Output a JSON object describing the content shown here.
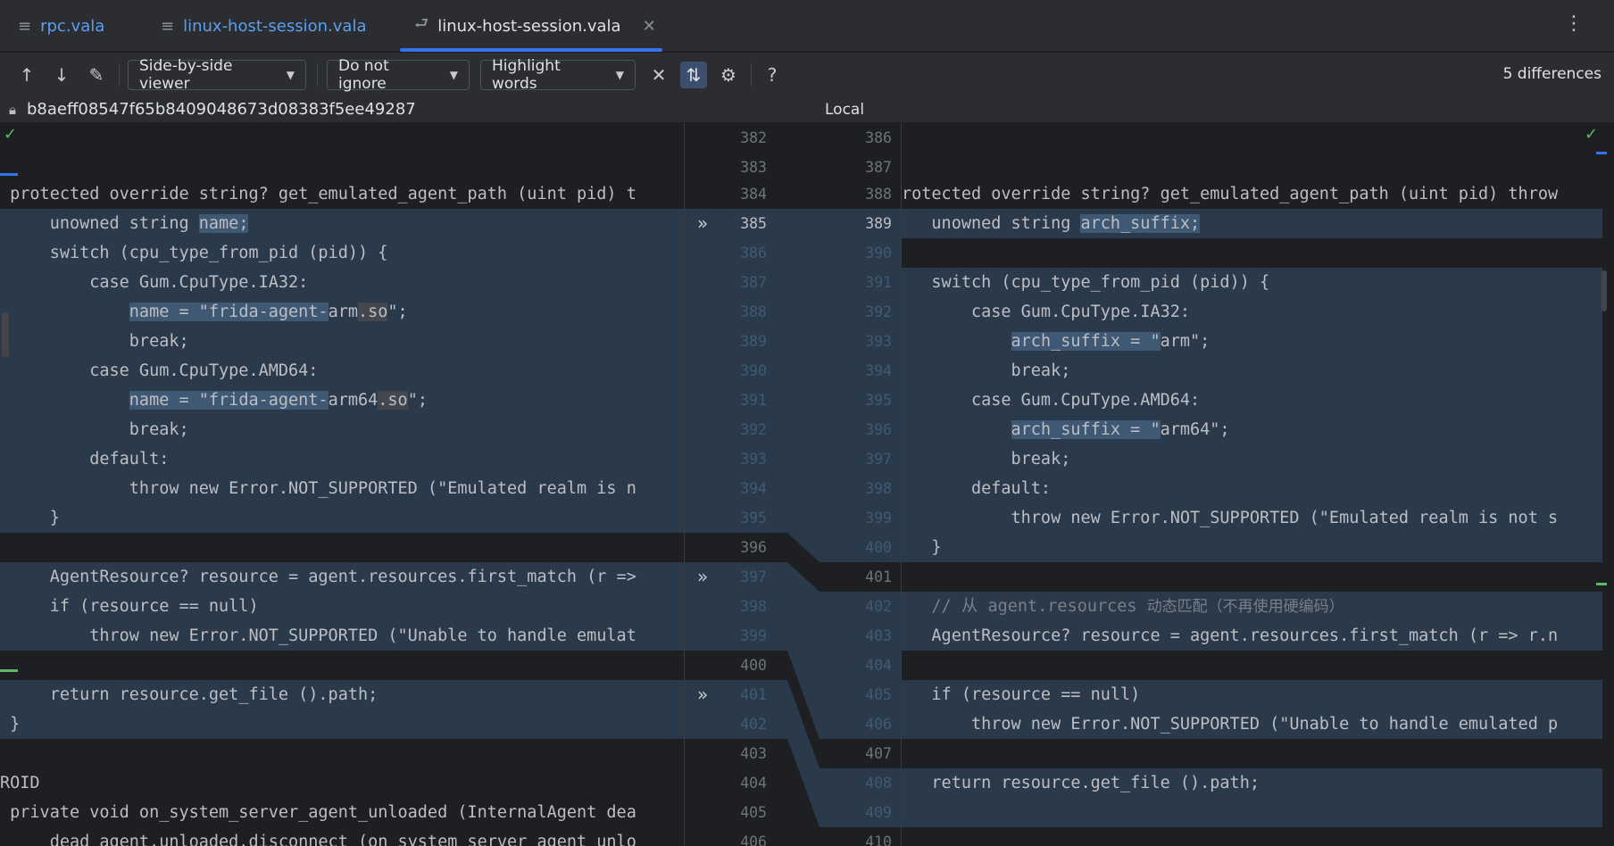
{
  "tabs": [
    {
      "label": "rpc.vala",
      "icon": "text-file-icon"
    },
    {
      "label": "linux-host-session.vala",
      "icon": "text-file-icon"
    },
    {
      "label": "linux-host-session.vala",
      "icon": "diff-icon"
    }
  ],
  "toolbar": {
    "viewer": "Side-by-side viewer",
    "ignore": "Do not ignore",
    "highlight": "Highlight words",
    "differences": "5 differences"
  },
  "title": {
    "left_revision": "b8aeff08547f65b8409048673d08383f5ee49287",
    "right": "Local"
  },
  "left_lines": [
    {
      "n": "382",
      "text": ""
    },
    {
      "n": "383",
      "text": ""
    },
    {
      "n": "384",
      "text": " protected override string? get_emulated_agent_path (uint pid) t"
    },
    {
      "n": "385",
      "text": "     unowned string name;"
    },
    {
      "n": "386",
      "text": "     switch (cpu_type_from_pid (pid)) {"
    },
    {
      "n": "387",
      "text": "         case Gum.CpuType.IA32:"
    },
    {
      "n": "388",
      "text": "             name = \"frida-agent-arm.so\";"
    },
    {
      "n": "389",
      "text": "             break;"
    },
    {
      "n": "390",
      "text": "         case Gum.CpuType.AMD64:"
    },
    {
      "n": "391",
      "text": "             name = \"frida-agent-arm64.so\";"
    },
    {
      "n": "392",
      "text": "             break;"
    },
    {
      "n": "393",
      "text": "         default:"
    },
    {
      "n": "394",
      "text": "             throw new Error.NOT_SUPPORTED (\"Emulated realm is n"
    },
    {
      "n": "395",
      "text": "     }"
    },
    {
      "n": "396",
      "text": ""
    },
    {
      "n": "397",
      "text": "     AgentResource? resource = agent.resources.first_match (r =>"
    },
    {
      "n": "398",
      "text": "     if (resource == null)"
    },
    {
      "n": "399",
      "text": "         throw new Error.NOT_SUPPORTED (\"Unable to handle emulat"
    },
    {
      "n": "400",
      "text": ""
    },
    {
      "n": "401",
      "text": "     return resource.get_file ().path;"
    },
    {
      "n": "402",
      "text": " }"
    },
    {
      "n": "403",
      "text": ""
    },
    {
      "n": "404",
      "text": "ROID"
    },
    {
      "n": "405",
      "text": " private void on_system_server_agent_unloaded (InternalAgent dea"
    },
    {
      "n": "406",
      "text": "     dead_agent.unloaded.disconnect (on_system_server_agent_unlo"
    }
  ],
  "right_lines": [
    {
      "n": "386",
      "text": ""
    },
    {
      "n": "387",
      "text": ""
    },
    {
      "n": "388",
      "text": "rotected override string? get_emulated_agent_path (uint pid) throw"
    },
    {
      "n": "389",
      "text": "   unowned string arch_suffix;"
    },
    {
      "n": "390",
      "text": ""
    },
    {
      "n": "391",
      "text": "   switch (cpu_type_from_pid (pid)) {"
    },
    {
      "n": "392",
      "text": "       case Gum.CpuType.IA32:"
    },
    {
      "n": "393",
      "text": "           arch_suffix = \"arm\";"
    },
    {
      "n": "394",
      "text": "           break;"
    },
    {
      "n": "395",
      "text": "       case Gum.CpuType.AMD64:"
    },
    {
      "n": "396",
      "text": "           arch_suffix = \"arm64\";"
    },
    {
      "n": "397",
      "text": "           break;"
    },
    {
      "n": "398",
      "text": "       default:"
    },
    {
      "n": "399",
      "text": "           throw new Error.NOT_SUPPORTED (\"Emulated realm is not s"
    },
    {
      "n": "400",
      "text": "   }"
    },
    {
      "n": "401",
      "text": ""
    },
    {
      "n": "402",
      "text_comment": "   // 从 agent.resources ",
      "text_cjk": "动态匹配（不再使用硬编码）"
    },
    {
      "n": "403",
      "text": "   AgentResource? resource = agent.resources.first_match (r => r.n"
    },
    {
      "n": "404",
      "text": ""
    },
    {
      "n": "405",
      "text": "   if (resource == null)"
    },
    {
      "n": "406",
      "text": "       throw new Error.NOT_SUPPORTED (\"Unable to handle emulated p"
    },
    {
      "n": "407",
      "text": ""
    },
    {
      "n": "408",
      "text": "   return resource.get_file ().path;"
    },
    {
      "n": "409",
      "text": ""
    },
    {
      "n": "410",
      "text": ""
    }
  ]
}
